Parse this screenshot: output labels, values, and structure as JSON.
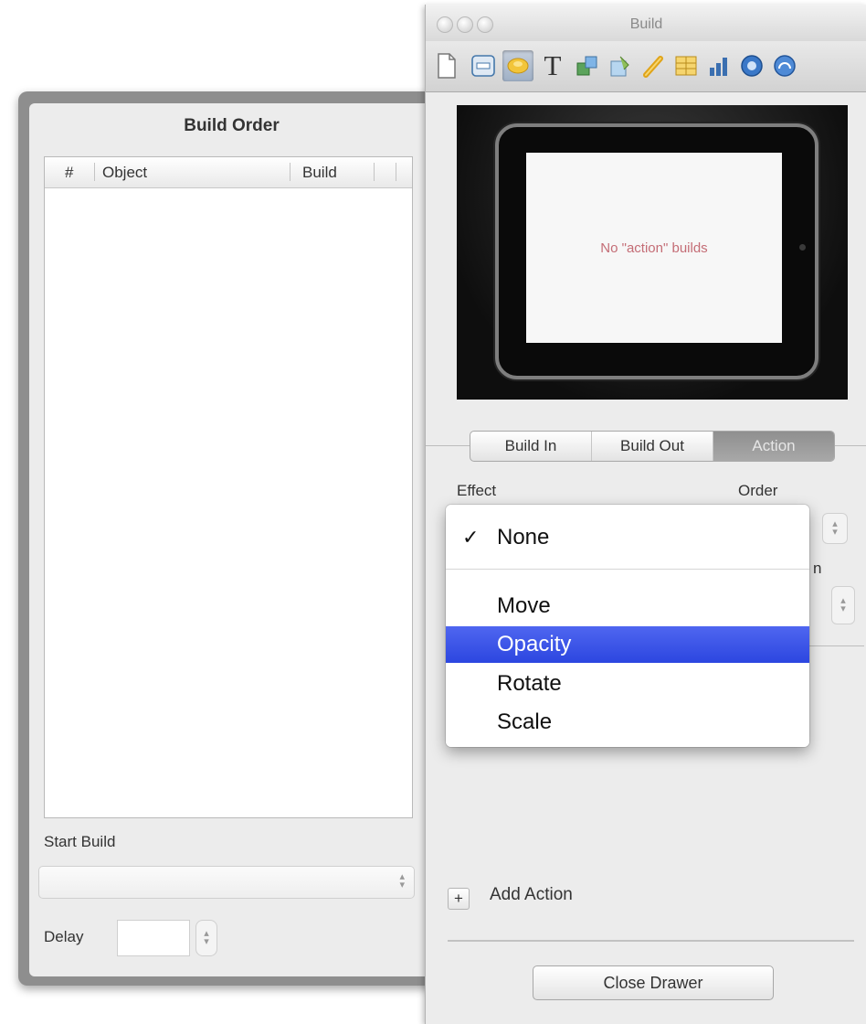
{
  "drawer": {
    "title": "Build Order",
    "table": {
      "columns": [
        "#",
        "Object",
        "Build"
      ],
      "rows": []
    },
    "start_build_label": "Start Build",
    "start_build_value": "",
    "delay_label": "Delay",
    "delay_value": ""
  },
  "inspector": {
    "window_title": "Build",
    "toolbar_icons": [
      "document-icon",
      "slide-icon",
      "build-icon",
      "text-icon",
      "graphic-icon",
      "metrics-icon",
      "hyperlink-icon",
      "table-icon",
      "chart-icon",
      "quicktime-icon",
      "audio-icon"
    ],
    "active_toolbar_icon": "build-icon",
    "preview_text": "No \"action\" builds",
    "tabs": [
      {
        "label": "Build In"
      },
      {
        "label": "Build Out"
      },
      {
        "label": "Action"
      }
    ],
    "selected_tab": "Action",
    "effect_label": "Effect",
    "order_label": "Order",
    "duration_label_partial": "n",
    "effect_menu": {
      "checked": "None",
      "highlighted": "Opacity",
      "items": [
        {
          "label": "None",
          "check": "✓"
        },
        {
          "label": "Move"
        },
        {
          "label": "Opacity"
        },
        {
          "label": "Rotate"
        },
        {
          "label": "Scale"
        }
      ]
    },
    "add_action_symbol": "+",
    "add_action_label": "Add Action",
    "close_drawer_label": "Close Drawer"
  },
  "colors": {
    "menu_highlight": "#3552e8",
    "selected_tab": "#9a9a9a",
    "preview_text": "#c46d76"
  }
}
